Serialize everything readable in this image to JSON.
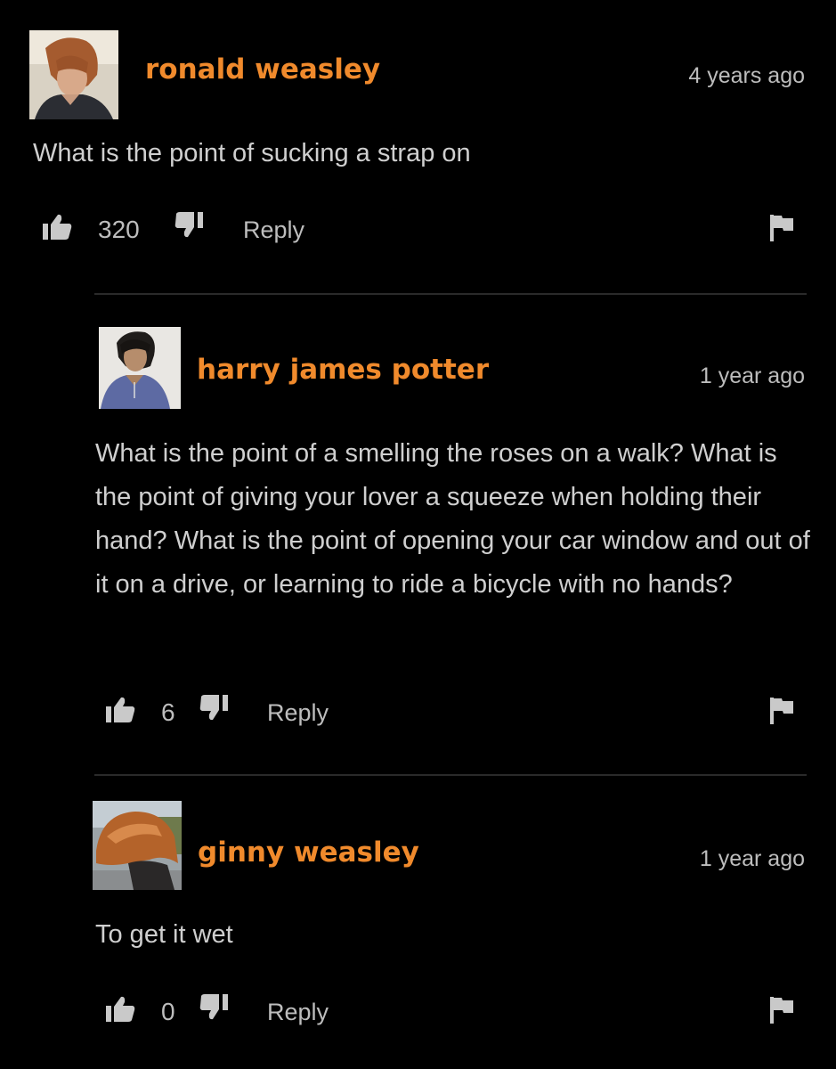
{
  "comments": [
    {
      "username": "ronald weasley",
      "timestamp": "4 years ago",
      "body": "What is the point of sucking a strap on",
      "likes": "320",
      "reply_label": "Reply"
    },
    {
      "username": "harry james potter",
      "timestamp": "1 year ago",
      "body": "What is the point of a smelling the roses on a walk? What is the point of giving your lover a squeeze when holding their hand? What is the point of opening your car window and out of it on a drive, or learning to ride a bicycle with no hands?",
      "likes": "6",
      "reply_label": "Reply"
    },
    {
      "username": "ginny weasley",
      "timestamp": "1 year ago",
      "body": "To get it wet",
      "likes": "0",
      "reply_label": "Reply"
    }
  ],
  "colors": {
    "background": "#000000",
    "username": "#f08a2c",
    "text": "#cfcfcf",
    "muted": "#bdbdbd",
    "divider": "#2a2a2a"
  },
  "icons": {
    "like": "thumbs-up-icon",
    "dislike": "thumbs-down-icon",
    "report": "flag-icon"
  }
}
